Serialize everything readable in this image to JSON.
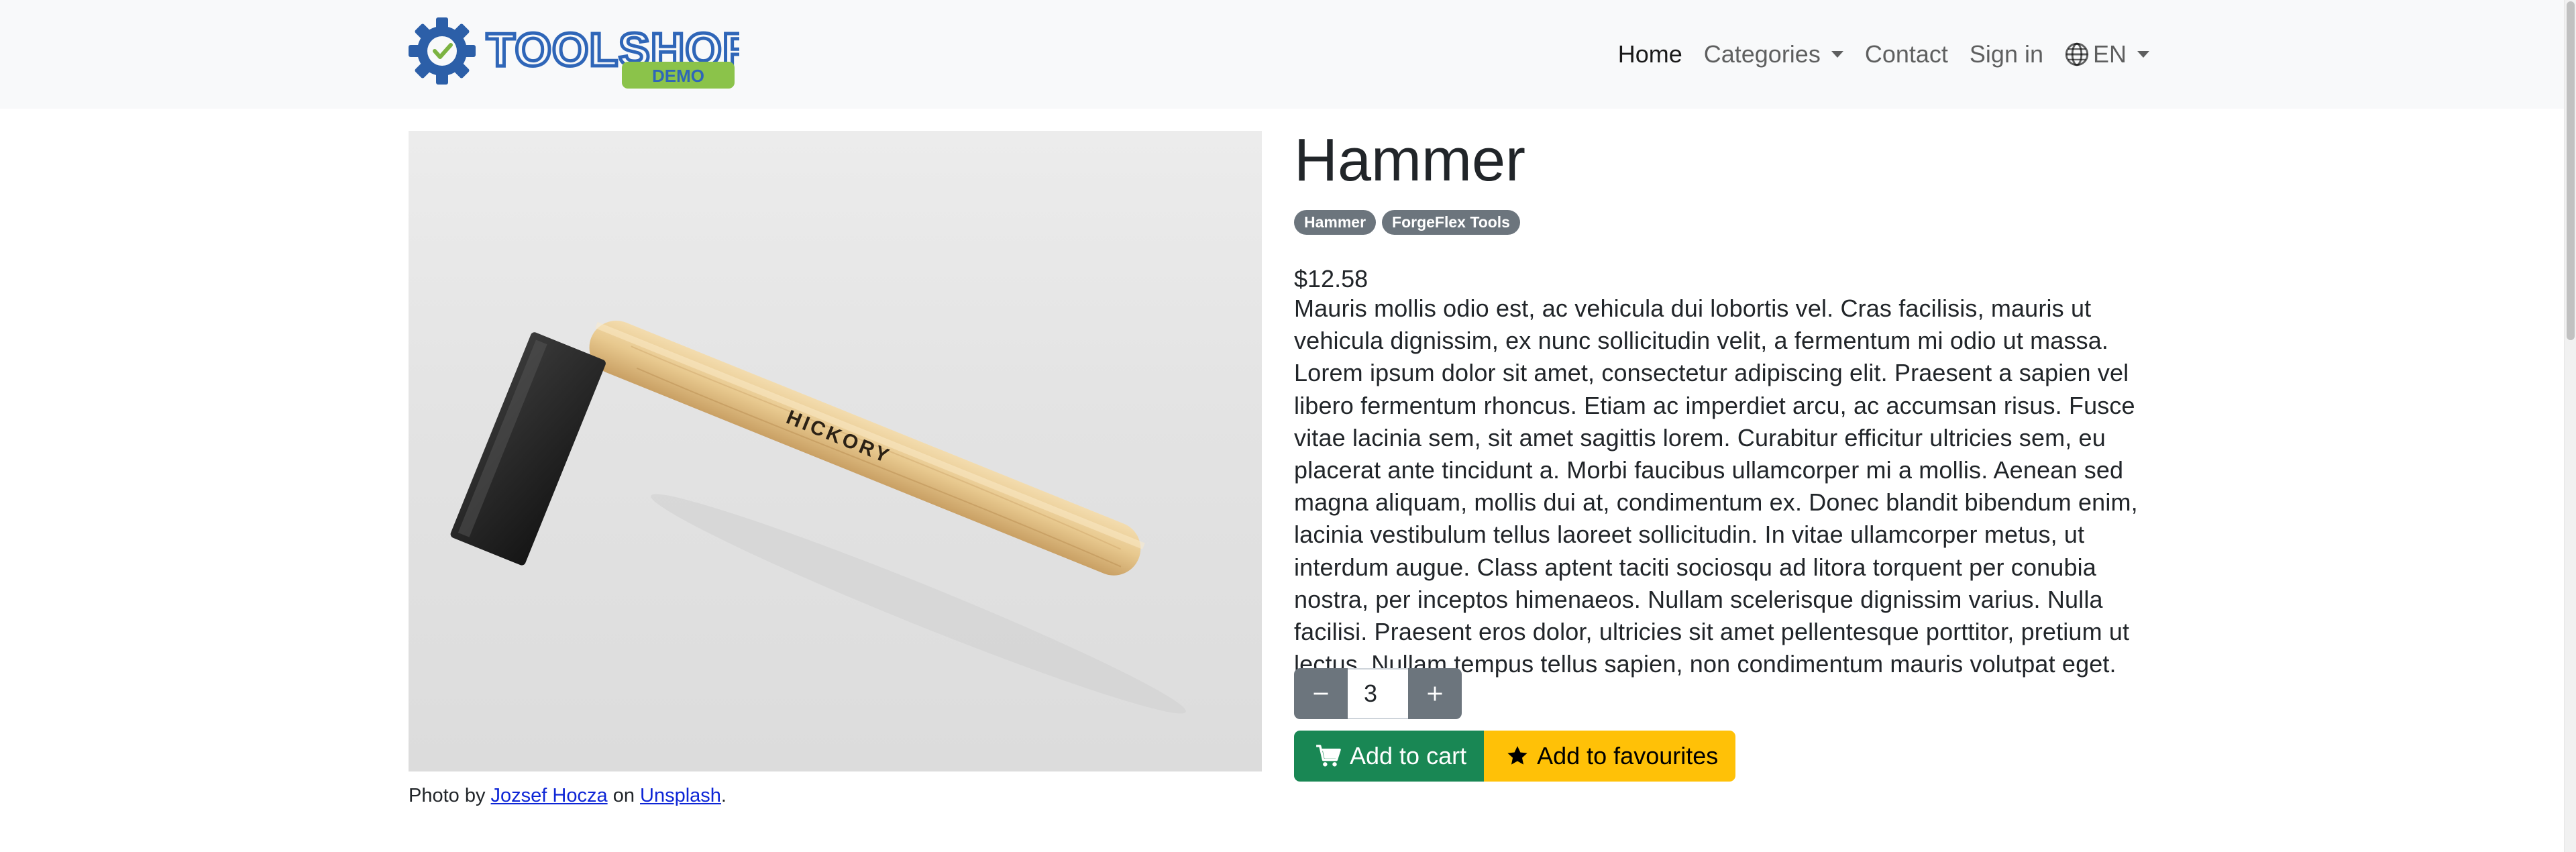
{
  "brand": {
    "name": "TOOLSHOP",
    "tag": "DEMO",
    "colors": {
      "gear": "#2c5fa8",
      "text": "#2f66b8",
      "check": "#7cb342",
      "demo": "#8bc34a"
    }
  },
  "nav": {
    "home": "Home",
    "categories": "Categories",
    "contact": "Contact",
    "sign_in": "Sign in",
    "language": "EN"
  },
  "product": {
    "name": "Hammer",
    "badges": [
      "Hammer",
      "ForgeFlex Tools"
    ],
    "price": "$12.58",
    "description": "Mauris mollis odio est, ac vehicula dui lobortis vel. Cras facilisis, mauris ut vehicula dignissim, ex nunc sollicitudin velit, a fermentum mi odio ut massa. Lorem ipsum dolor sit amet, consectetur adipiscing elit. Praesent a sapien vel libero fermentum rhoncus. Etiam ac imperdiet arcu, ac accumsan risus. Fusce vitae lacinia sem, sit amet sagittis lorem. Curabitur efficitur ultricies sem, eu placerat ante tincidunt a. Morbi faucibus ullamcorper mi a mollis. Aenean sed magna aliquam, mollis dui at, condimentum ex. Donec blandit bibendum enim, lacinia vestibulum tellus laoreet sollicitudin. In vitae ullamcorper metus, ut interdum augue. Class aptent taciti sociosqu ad litora torquent per conubia nostra, per inceptos himenaeos. Nullam scelerisque dignissim varius. Nulla facilisi. Praesent eros dolor, ultricies sit amet pellentesque porttitor, pretium ut lectus. Nullam tempus tellus sapien, non condimentum mauris volutpat eget.",
    "image_handle_text": "HICKORY",
    "quantity": "3",
    "add_to_cart": "Add to cart",
    "add_to_favourites": "Add to favourites",
    "colors": {
      "cart": "#198754",
      "favourites": "#ffc107",
      "qty_buttons": "#6c757d",
      "badge": "#6c757d"
    }
  },
  "photo_credit": {
    "prefix": "Photo by",
    "author": "Jozsef Hocza",
    "middle": "on",
    "site": "Unsplash",
    "suffix": "."
  }
}
